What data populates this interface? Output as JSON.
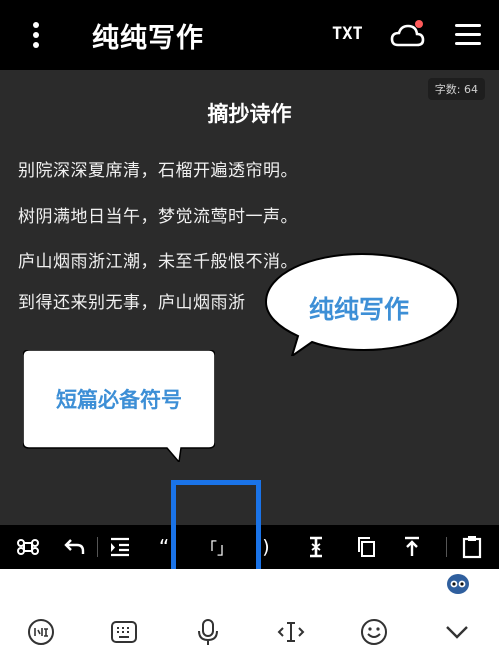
{
  "header": {
    "title": "纯纯写作",
    "txt_label": "TXT"
  },
  "editor": {
    "word_count": "字数: 64",
    "doc_title": "摘抄诗作",
    "lines": [
      "别院深深夏席清，石榴开遍透帘明。",
      "树阴满地日当午，梦觉流莺时一声。",
      "庐山烟雨浙江潮，未至千般恨不消。",
      "到得还来别无事，庐山烟雨浙"
    ]
  },
  "callouts": {
    "right": "纯纯写作",
    "left": "短篇必备符号"
  },
  "toolbar": {
    "quote_symbol": "“",
    "bracket_symbol": "「」",
    "paren_symbol": ")"
  },
  "colors": {
    "accent": "#3d8fd6",
    "highlight": "#1a73e8",
    "notification_dot": "#ff5a5a"
  }
}
